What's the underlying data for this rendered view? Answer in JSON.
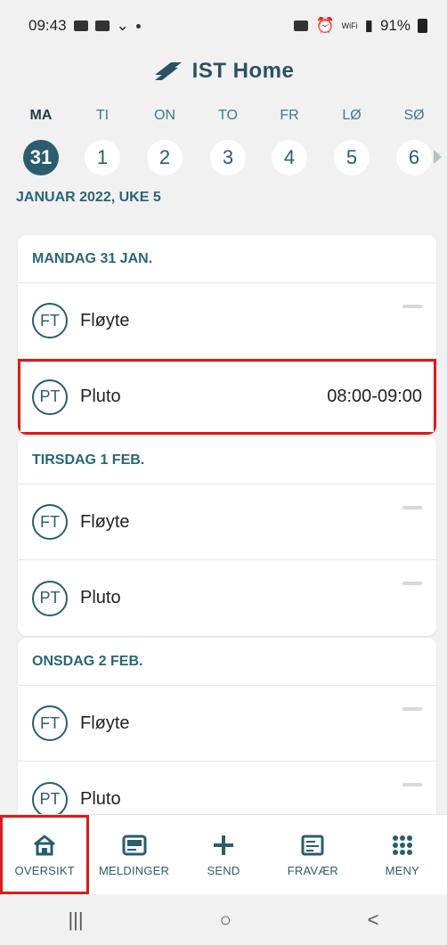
{
  "status_bar": {
    "time": "09:43",
    "battery": "91%",
    "wifi_label": "WiFi"
  },
  "app": {
    "logo_text": "IST Home"
  },
  "week": {
    "days": [
      {
        "label": "MA",
        "date": "31",
        "active": true
      },
      {
        "label": "TI",
        "date": "1",
        "active": false
      },
      {
        "label": "ON",
        "date": "2",
        "active": false
      },
      {
        "label": "TO",
        "date": "3",
        "active": false
      },
      {
        "label": "FR",
        "date": "4",
        "active": false
      },
      {
        "label": "LØ",
        "date": "5",
        "active": false
      },
      {
        "label": "SØ",
        "date": "6",
        "active": false
      }
    ],
    "title": "JANUAR 2022, UKE 5"
  },
  "cards": [
    {
      "header": "MANDAG 31 JAN.",
      "rows": [
        {
          "initials": "FT",
          "subject": "Fløyte",
          "time": ""
        },
        {
          "initials": "PT",
          "subject": "Pluto",
          "time": "08:00-09:00"
        }
      ]
    },
    {
      "header": "TIRSDAG 1 FEB.",
      "rows": [
        {
          "initials": "FT",
          "subject": "Fløyte",
          "time": ""
        },
        {
          "initials": "PT",
          "subject": "Pluto",
          "time": ""
        }
      ]
    },
    {
      "header": "ONSDAG 2 FEB.",
      "rows": [
        {
          "initials": "FT",
          "subject": "Fløyte",
          "time": ""
        },
        {
          "initials": "PT",
          "subject": "Pluto",
          "time": ""
        }
      ]
    }
  ],
  "bottom_nav": [
    {
      "label": "OVERSIKT",
      "icon": "home-icon"
    },
    {
      "label": "MELDINGER",
      "icon": "message-icon"
    },
    {
      "label": "SEND",
      "icon": "plus-icon"
    },
    {
      "label": "FRAVÆR",
      "icon": "document-icon"
    },
    {
      "label": "MENY",
      "icon": "grid-icon"
    }
  ],
  "system_nav": {
    "recents": "|||",
    "home": "○",
    "back": "<"
  },
  "colors": {
    "primary": "#2a5d6e",
    "accent_text": "#2a6578",
    "highlight": "#e01818",
    "background": "#f1f1f1"
  }
}
